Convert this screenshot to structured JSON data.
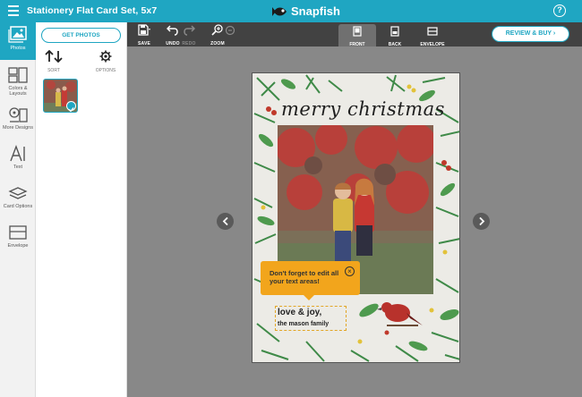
{
  "header": {
    "title": "Stationery Flat Card Set, 5x7",
    "brand": "Snapfish",
    "help_label": "?"
  },
  "rail": {
    "items": [
      {
        "label": "Photos",
        "icon": "photos-icon",
        "active": true
      },
      {
        "label": "Colors & Layouts",
        "icon": "layouts-icon"
      },
      {
        "label": "More Designs",
        "icon": "designs-icon"
      },
      {
        "label": "Text",
        "icon": "text-icon"
      },
      {
        "label": "Card Options",
        "icon": "card-options-icon"
      },
      {
        "label": "Envelope",
        "icon": "envelope-icon"
      }
    ]
  },
  "panel": {
    "get_photos_label": "GET PHOTOS",
    "sort_label": "SORT",
    "options_label": "OPTIONS"
  },
  "toolbar": {
    "save_label": "SAVE",
    "undo_label": "UNDO",
    "redo_label": "REDO",
    "zoom_label": "ZOOM",
    "views": [
      {
        "label": "FRONT",
        "active": true
      },
      {
        "label": "BACK"
      },
      {
        "label": "ENVELOPE"
      }
    ],
    "review_label": "REVIEW & BUY"
  },
  "card": {
    "greeting": "merry christmas",
    "line1": "love & joy,",
    "line2": "the mason family"
  },
  "tooltip": {
    "text": "Don't forget to edit all your text areas!"
  },
  "colors": {
    "brand": "#1fa6c2",
    "toolbar": "#424242",
    "canvas": "#888888",
    "tooltip": "#f2a51c"
  }
}
